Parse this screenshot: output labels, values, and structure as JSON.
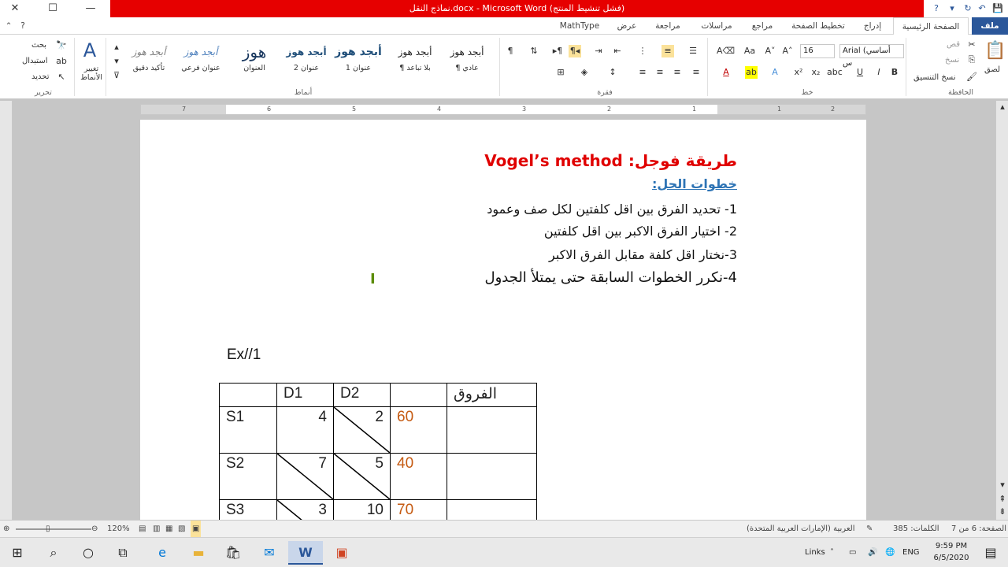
{
  "window": {
    "title": "نماذج النقل.docx - Microsoft Word (فشل تنشيط المنتج)",
    "help": "?",
    "controls": [
      "—",
      "☐",
      "✕"
    ]
  },
  "tabs": [
    {
      "label": "ملف",
      "key": "file"
    },
    {
      "label": "الصفحة الرئيسية",
      "key": "home"
    },
    {
      "label": "إدراج",
      "key": "insert"
    },
    {
      "label": "تخطيط الصفحة",
      "key": "layout"
    },
    {
      "label": "مراجع",
      "key": "references"
    },
    {
      "label": "مراسلات",
      "key": "mailings"
    },
    {
      "label": "مراجعة",
      "key": "review"
    },
    {
      "label": "عرض",
      "key": "view"
    },
    {
      "label": "MathType",
      "key": "mathtype"
    }
  ],
  "ribbon": {
    "clipboard": {
      "group": "الحافظة",
      "paste": "لصق",
      "cut": "قص",
      "copy": "نسخ",
      "format_painter": "نسخ التنسيق"
    },
    "font": {
      "group": "خط",
      "name": "Arial (أساسي س",
      "size": "16"
    },
    "paragraph": {
      "group": "فقرة"
    },
    "styles": {
      "group": "أنماط",
      "items": [
        {
          "preview": "أبجد هوز",
          "name": "¶ عادي"
        },
        {
          "preview": "أبجد هوز",
          "name": "¶ بلا تباعد"
        },
        {
          "preview": "أبجد هوز",
          "name": "عنوان 1"
        },
        {
          "preview": "أبجد هوز",
          "name": "عنوان 2"
        },
        {
          "preview": "هوز",
          "name": "العنوان"
        },
        {
          "preview": "أبجد هوز",
          "name": "عنوان فرعي"
        },
        {
          "preview": "أبجد هوز",
          "name": "تأكيد دقيق"
        }
      ],
      "change": "تغيير الأنماط"
    },
    "editing": {
      "group": "تحرير",
      "find": "بحث",
      "replace": "استبدال",
      "select": "تحديد"
    }
  },
  "ruler": {
    "numbers": [
      "7",
      "6",
      "5",
      "4",
      "3",
      "2",
      "1",
      "1",
      "2"
    ]
  },
  "document": {
    "title": "طريقة فوجل:   Vogel’s method",
    "subtitle": "خطوات الحل:",
    "steps": [
      "1- تحديد الفرق بين اقل كلفتين لكل صف وعمود",
      "2- اختيار الفرق الاكبر بين اقل كلفتين",
      "3-نختار اقل كلفة مقابل الفرق الاكبر",
      "4-نكرر الخطوات السابقة حتى يمتلأ الجدول"
    ],
    "example_label": "Ex//1"
  },
  "table": {
    "headers": [
      "",
      "D1",
      "D2",
      "",
      "الفروق"
    ],
    "rows": [
      {
        "source": "S1",
        "d1": "4",
        "d2": "2",
        "supply": "60",
        "diff": "",
        "d1_crossed": false,
        "d2_crossed": true
      },
      {
        "source": "S2",
        "d1": "7",
        "d2": "5",
        "supply": "40",
        "diff": "",
        "d1_crossed": true,
        "d2_crossed": true
      },
      {
        "source": "S3",
        "d1": "3",
        "d2": "10",
        "supply": "70",
        "diff": "",
        "d1_crossed": true,
        "d2_crossed": false
      }
    ],
    "supply_color": "#c55a11"
  },
  "status": {
    "page": "الصفحة: 6 من 7",
    "words": "الكلمات: 385",
    "language": "العربية (الإمارات العربية المتحدة)",
    "zoom": "120%"
  },
  "taskbar": {
    "links": "Links",
    "lang": "ENG",
    "time": "9:59 PM",
    "date": "6/5/2020"
  },
  "colors": {
    "title_red": "#e00000",
    "subtitle_blue": "#2e74b5",
    "ribbon_blue": "#2b579a",
    "titlebar_red": "#e60000"
  }
}
